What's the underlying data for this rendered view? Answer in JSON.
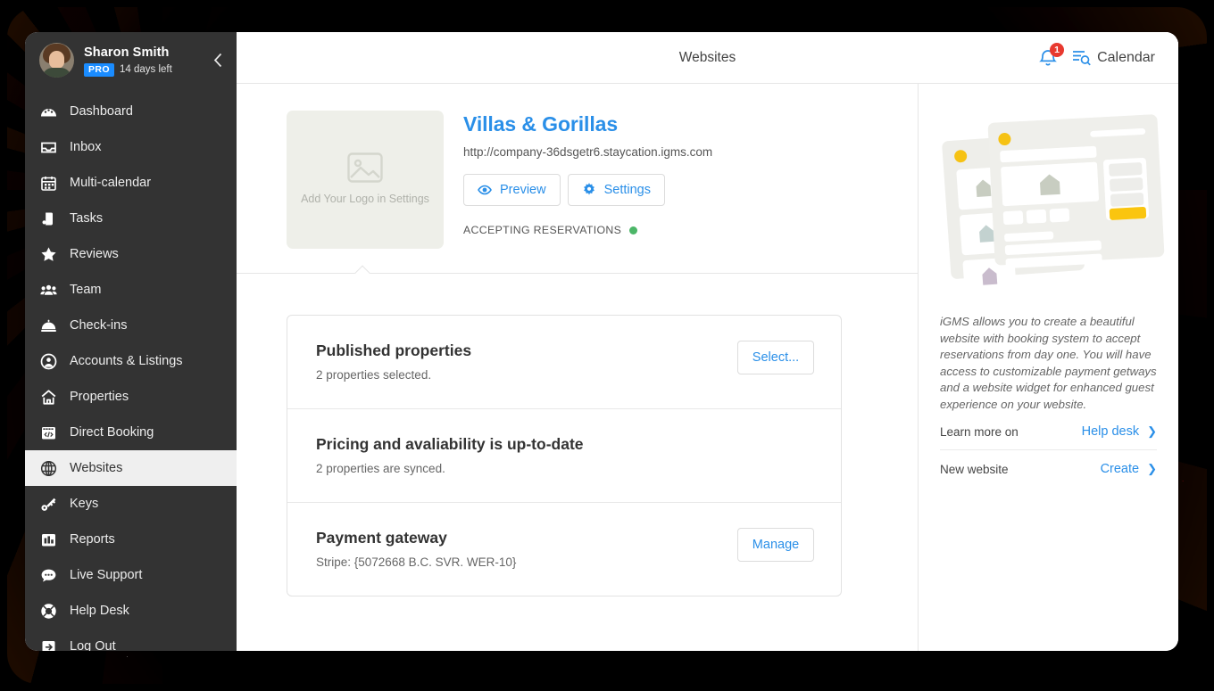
{
  "sidebar": {
    "profile": {
      "name": "Sharon Smith",
      "badge": "PRO",
      "trial": "14 days left"
    },
    "items": [
      {
        "label": "Dashboard",
        "icon": "dashboard-icon"
      },
      {
        "label": "Inbox",
        "icon": "inbox-icon"
      },
      {
        "label": "Multi-calendar",
        "icon": "calendar-icon"
      },
      {
        "label": "Tasks",
        "icon": "tasks-icon"
      },
      {
        "label": "Reviews",
        "icon": "star-icon"
      },
      {
        "label": "Team",
        "icon": "team-icon"
      },
      {
        "label": "Check-ins",
        "icon": "bell-desk-icon"
      },
      {
        "label": "Accounts & Listings",
        "icon": "account-circle-icon"
      },
      {
        "label": "Properties",
        "icon": "home-icon"
      },
      {
        "label": "Direct Booking",
        "icon": "code-window-icon"
      },
      {
        "label": "Websites",
        "icon": "globe-icon"
      },
      {
        "label": "Keys",
        "icon": "key-icon"
      },
      {
        "label": "Reports",
        "icon": "bar-chart-icon"
      },
      {
        "label": "Live Support",
        "icon": "chat-icon"
      },
      {
        "label": "Help Desk",
        "icon": "lifebuoy-icon"
      },
      {
        "label": "Log Out",
        "icon": "logout-icon"
      }
    ],
    "active_index": 10
  },
  "topbar": {
    "title": "Websites",
    "notification_count": "1",
    "calendar_label": "Calendar"
  },
  "site": {
    "logo_placeholder": "Add Your Logo in Settings",
    "name": "Villas & Gorillas",
    "url": "http://company-36dsgetr6.staycation.igms.com",
    "preview_label": "Preview",
    "settings_label": "Settings",
    "status_text": "ACCEPTING RESERVATIONS",
    "status_color": "#4cb668"
  },
  "cards": [
    {
      "title": "Published properties",
      "subtitle": "2 properties selected.",
      "action": "Select..."
    },
    {
      "title": "Pricing and avaliability is up-to-date",
      "subtitle": "2 properties are synced.",
      "action": ""
    },
    {
      "title": "Payment gateway",
      "subtitle": "Stripe: {5072668 B.C. SVR. WER-10}",
      "action": "Manage"
    }
  ],
  "rail": {
    "description": "iGMS allows you to create a beautiful website with booking system to accept reservations from day one. You will have access to customizable payment getways and a website widget for enhanced guest experience on your website.",
    "links": [
      {
        "label": "Learn more on",
        "action": "Help desk"
      },
      {
        "label": "New website",
        "action": "Create"
      }
    ]
  },
  "colors": {
    "accent": "#2a8fe8",
    "sidebar_bg": "#333333",
    "badge_blue": "#1a8cff",
    "badge_red": "#e8392f",
    "status_green": "#4cb668",
    "illus_yellow": "#f6c214"
  }
}
